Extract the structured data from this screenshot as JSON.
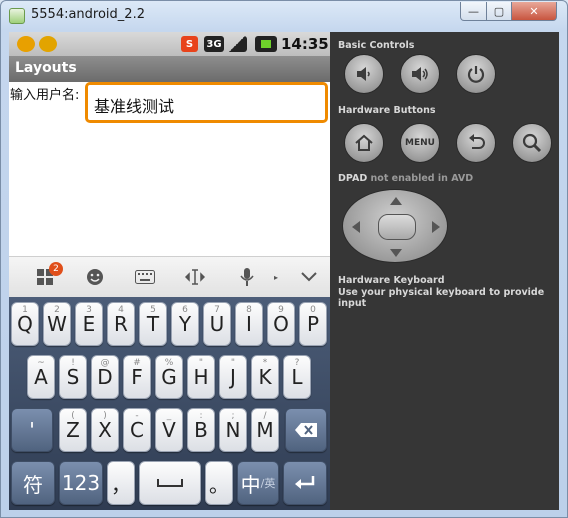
{
  "window": {
    "title": "5554:android_2.2",
    "minimize_glyph": "—",
    "maximize_glyph": "▢",
    "close_glyph": "✕"
  },
  "status_bar": {
    "time": "14:35",
    "icons": [
      "sohu-notify-icon",
      "sohu-ime-icon",
      "sogou-s-icon",
      "3g-icon",
      "signal-icon",
      "battery-icon"
    ],
    "sogou_text": "S",
    "network_text": "3G"
  },
  "app": {
    "title": "Layouts",
    "field_label": "输入用户名:",
    "field_value": "基准线测试",
    "accent_color": "#ef8a00"
  },
  "keyboard": {
    "row1": [
      {
        "main": "Q",
        "sub": "1"
      },
      {
        "main": "W",
        "sub": "2"
      },
      {
        "main": "E",
        "sub": "3"
      },
      {
        "main": "R",
        "sub": "4"
      },
      {
        "main": "T",
        "sub": "5"
      },
      {
        "main": "Y",
        "sub": "6"
      },
      {
        "main": "U",
        "sub": "7"
      },
      {
        "main": "I",
        "sub": "8"
      },
      {
        "main": "O",
        "sub": "9"
      },
      {
        "main": "P",
        "sub": "0"
      }
    ],
    "row2": [
      {
        "main": "A",
        "sub": "~"
      },
      {
        "main": "S",
        "sub": "!"
      },
      {
        "main": "D",
        "sub": "@"
      },
      {
        "main": "F",
        "sub": "#"
      },
      {
        "main": "G",
        "sub": "%"
      },
      {
        "main": "H",
        "sub": "\""
      },
      {
        "main": "J",
        "sub": "\""
      },
      {
        "main": "K",
        "sub": "*"
      },
      {
        "main": "L",
        "sub": "?"
      }
    ],
    "row3_left": "'",
    "row3": [
      {
        "main": "Z",
        "sub": "("
      },
      {
        "main": "X",
        "sub": ")"
      },
      {
        "main": "C",
        "sub": "-"
      },
      {
        "main": "V",
        "sub": "_"
      },
      {
        "main": "B",
        "sub": ":"
      },
      {
        "main": "N",
        "sub": ";"
      },
      {
        "main": "M",
        "sub": "/"
      }
    ],
    "row4": {
      "symbol": "符",
      "numbers": "123",
      "comma": "，",
      "period": "。",
      "lang_main": "中",
      "lang_sub": "/英"
    },
    "toolbar_badge": "2"
  },
  "controls": {
    "basic_label": "Basic Controls",
    "hardware_label": "Hardware Buttons",
    "menu_label": "MENU",
    "dpad_label": "DPAD",
    "dpad_note": "not enabled in AVD",
    "keyboard_label": "Hardware Keyboard",
    "keyboard_note": "Use your physical keyboard to provide input"
  }
}
